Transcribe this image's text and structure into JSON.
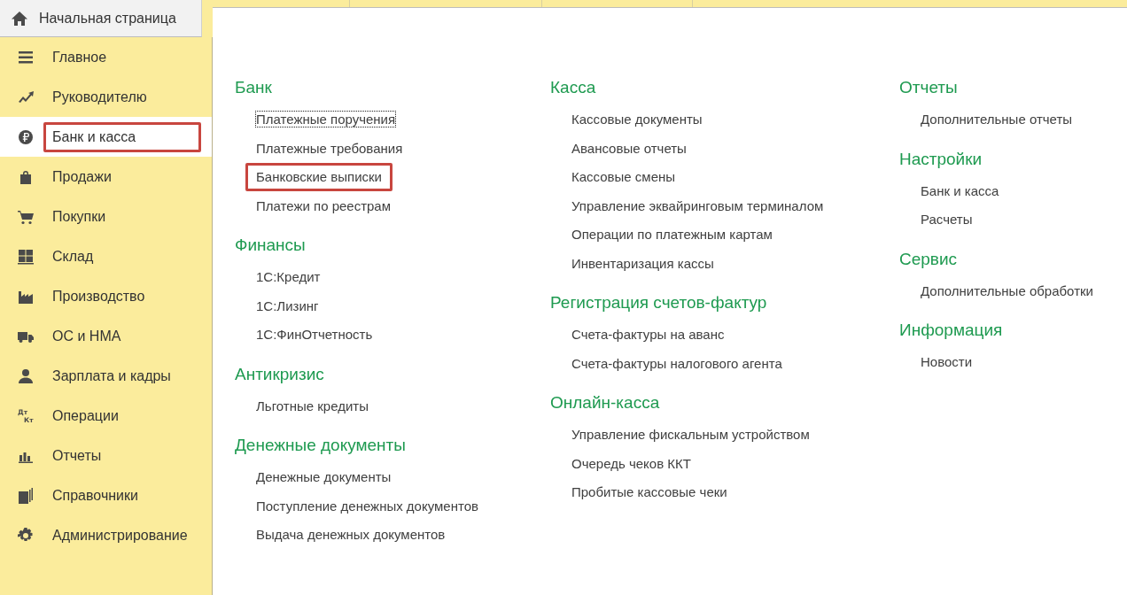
{
  "home_tab": {
    "label": "Начальная страница"
  },
  "sidebar": {
    "items": [
      {
        "label": "Главное",
        "selected": false,
        "highlighted": false
      },
      {
        "label": "Руководителю",
        "selected": false,
        "highlighted": false
      },
      {
        "label": "Банк и касса",
        "selected": true,
        "highlighted": true
      },
      {
        "label": "Продажи",
        "selected": false,
        "highlighted": false
      },
      {
        "label": "Покупки",
        "selected": false,
        "highlighted": false
      },
      {
        "label": "Склад",
        "selected": false,
        "highlighted": false
      },
      {
        "label": "Производство",
        "selected": false,
        "highlighted": false
      },
      {
        "label": "ОС и НМА",
        "selected": false,
        "highlighted": false
      },
      {
        "label": "Зарплата и кадры",
        "selected": false,
        "highlighted": false
      },
      {
        "label": "Операции",
        "selected": false,
        "highlighted": false,
        "icon_text": [
          "Дт",
          "Кт"
        ]
      },
      {
        "label": "Отчеты",
        "selected": false,
        "highlighted": false
      },
      {
        "label": "Справочники",
        "selected": false,
        "highlighted": false
      },
      {
        "label": "Администрирование",
        "selected": false,
        "highlighted": false
      }
    ]
  },
  "columns": [
    {
      "sections": [
        {
          "title": "Банк",
          "links": [
            {
              "label": "Платежные поручения",
              "focused": true,
              "highlighted": false
            },
            {
              "label": "Платежные требования",
              "focused": false,
              "highlighted": false
            },
            {
              "label": "Банковские выписки",
              "focused": false,
              "highlighted": true
            },
            {
              "label": "Платежи по реестрам",
              "focused": false,
              "highlighted": false
            }
          ]
        },
        {
          "title": "Финансы",
          "links": [
            {
              "label": "1С:Кредит",
              "focused": false,
              "highlighted": false
            },
            {
              "label": "1С:Лизинг",
              "focused": false,
              "highlighted": false
            },
            {
              "label": "1С:ФинОтчетность",
              "focused": false,
              "highlighted": false
            }
          ]
        },
        {
          "title": "Антикризис",
          "links": [
            {
              "label": "Льготные кредиты",
              "focused": false,
              "highlighted": false
            }
          ]
        },
        {
          "title": "Денежные документы",
          "links": [
            {
              "label": "Денежные документы",
              "focused": false,
              "highlighted": false
            },
            {
              "label": "Поступление денежных документов",
              "focused": false,
              "highlighted": false
            },
            {
              "label": "Выдача денежных документов",
              "focused": false,
              "highlighted": false
            }
          ]
        }
      ]
    },
    {
      "sections": [
        {
          "title": "Касса",
          "links": [
            {
              "label": "Кассовые документы",
              "focused": false,
              "highlighted": false
            },
            {
              "label": "Авансовые отчеты",
              "focused": false,
              "highlighted": false
            },
            {
              "label": "Кассовые смены",
              "focused": false,
              "highlighted": false
            },
            {
              "label": "Управление эквайринговым терминалом",
              "focused": false,
              "highlighted": false
            },
            {
              "label": "Операции по платежным картам",
              "focused": false,
              "highlighted": false
            },
            {
              "label": "Инвентаризация кассы",
              "focused": false,
              "highlighted": false
            }
          ]
        },
        {
          "title": "Регистрация счетов-фактур",
          "links": [
            {
              "label": "Счета-фактуры на аванс",
              "focused": false,
              "highlighted": false
            },
            {
              "label": "Счета-фактуры налогового агента",
              "focused": false,
              "highlighted": false
            }
          ]
        },
        {
          "title": "Онлайн-касса",
          "links": [
            {
              "label": "Управление фискальным устройством",
              "focused": false,
              "highlighted": false
            },
            {
              "label": "Очередь чеков ККТ",
              "focused": false,
              "highlighted": false
            },
            {
              "label": "Пробитые кассовые чеки",
              "focused": false,
              "highlighted": false
            }
          ]
        }
      ]
    },
    {
      "sections": [
        {
          "title": "Отчеты",
          "links": [
            {
              "label": "Дополнительные отчеты",
              "focused": false,
              "highlighted": false
            }
          ]
        },
        {
          "title": "Настройки",
          "links": [
            {
              "label": "Банк и касса",
              "focused": false,
              "highlighted": false
            },
            {
              "label": "Расчеты",
              "focused": false,
              "highlighted": false
            }
          ]
        },
        {
          "title": "Сервис",
          "links": [
            {
              "label": "Дополнительные обработки",
              "focused": false,
              "highlighted": false
            }
          ]
        },
        {
          "title": "Информация",
          "links": [
            {
              "label": "Новости",
              "focused": false,
              "highlighted": false
            }
          ]
        }
      ]
    }
  ]
}
